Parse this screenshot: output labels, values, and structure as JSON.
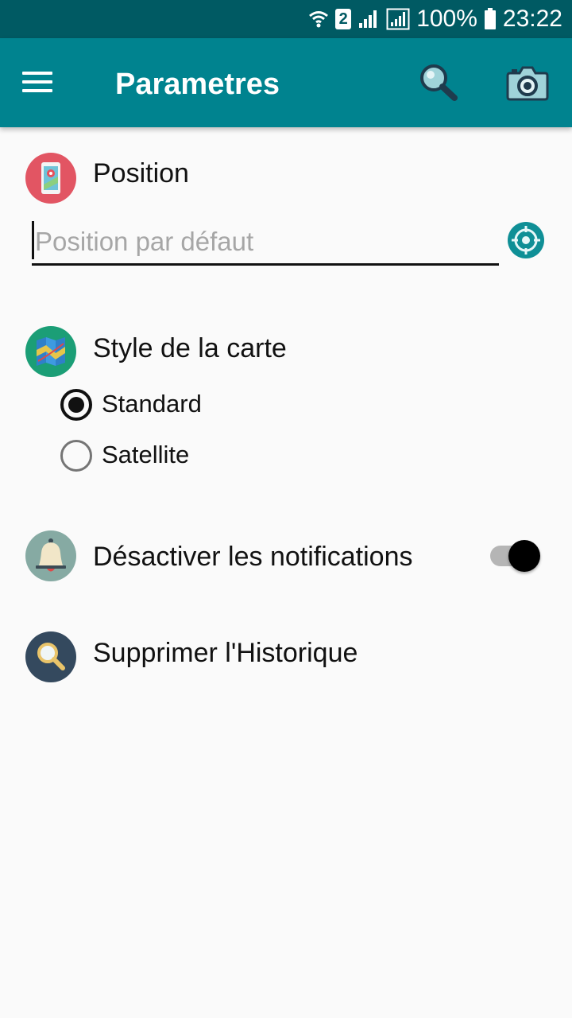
{
  "status_bar": {
    "battery": "100%",
    "time": "23:22",
    "sim_slot": "2",
    "icons": [
      "wifi-icon",
      "sim-2-icon",
      "signal-icon",
      "signal-icon",
      "battery-icon"
    ]
  },
  "toolbar": {
    "title": "Parametres",
    "icons": [
      "menu-icon",
      "search-icon",
      "camera-icon"
    ],
    "background_color": "#00838f"
  },
  "position": {
    "label": "Position",
    "input_value": "",
    "input_placeholder": "Position par défaut",
    "icon": "phone-map-pin-icon",
    "locate_icon": "crosshair-icon"
  },
  "map_style": {
    "label": "Style de la carte",
    "icon": "map-icon",
    "options": [
      {
        "label": "Standard",
        "selected": true
      },
      {
        "label": "Satellite",
        "selected": false
      }
    ]
  },
  "notifications": {
    "label": "Désactiver les notifications",
    "icon": "bell-icon",
    "enabled": true
  },
  "history": {
    "label": "Supprimer l'Historique",
    "icon": "magnifier-icon"
  }
}
